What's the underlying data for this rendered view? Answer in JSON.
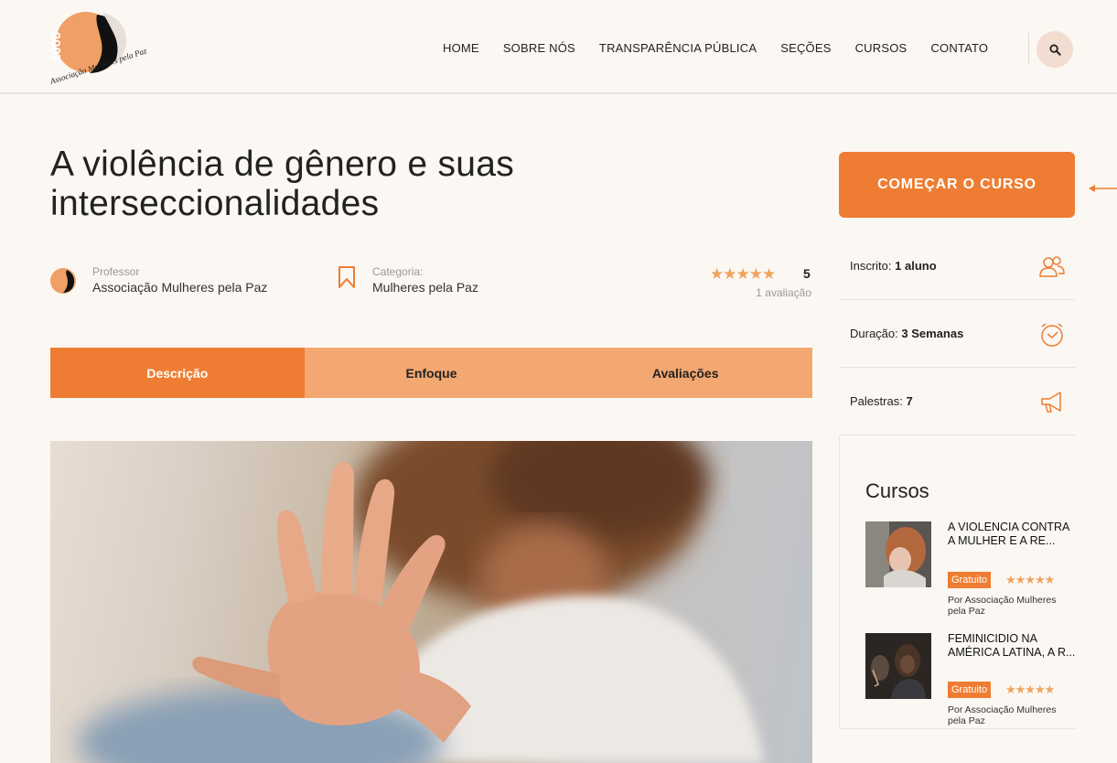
{
  "brand": {
    "logo_text": "1000",
    "logo_name": "Associação Mulheres pela Paz"
  },
  "nav": {
    "items": [
      "HOME",
      "SOBRE NÓS",
      "TRANSPARÊNCIA PÚBLICA",
      "SEÇÕES",
      "CURSOS",
      "CONTATO"
    ],
    "search_icon": "search-icon"
  },
  "course": {
    "title_line1": "A violência de gênero e suas",
    "title_line2": "interseccionalidades",
    "professor_label": "Professor",
    "professor_name": "Associação Mulheres pela Paz",
    "category_label": "Categoria:",
    "category_name": "Mulheres pela Paz",
    "rating_stars": "★★★★★",
    "rating_value": "5",
    "rating_count": "1 avaliação"
  },
  "tabs": [
    {
      "label": "Descrição",
      "active": true
    },
    {
      "label": "Enfoque",
      "active": false
    },
    {
      "label": "Avaliações",
      "active": false
    }
  ],
  "sidebar": {
    "cta_label": "COMEÇAR O CURSO",
    "enrolled_label": "Inscrito:",
    "enrolled_value": "1 aluno",
    "duration_label": "Duração:",
    "duration_value": "3 Semanas",
    "lectures_label": "Palestras:",
    "lectures_value": "7",
    "courses_title": "Cursos",
    "courses": [
      {
        "title": "A VIOLENCIA CONTRA A MULHER E A RE...",
        "badge": "Gratuito",
        "stars": "★★★★★",
        "by": "Por Associação Mulheres pela Paz"
      },
      {
        "title": "FEMINICIDIO NA AMÉRICA LATINA, A R...",
        "badge": "Gratuito",
        "stars": "★★★★★",
        "by": "Por Associação Mulheres pela Paz"
      }
    ]
  },
  "colors": {
    "accent": "#ee7d33",
    "accent_light": "#f3a771",
    "star": "#f0a35e",
    "background": "#fbf7f3"
  }
}
